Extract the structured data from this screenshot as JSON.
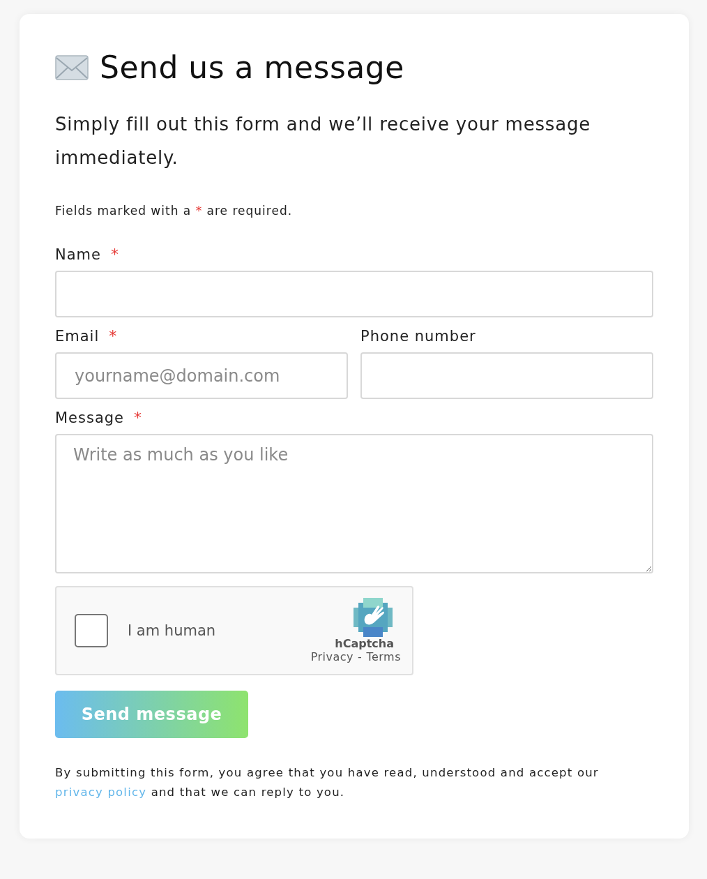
{
  "title": "Send us a message",
  "intro": "Simply fill out this form and we’ll receive your message immediately.",
  "required_note": {
    "before": "Fields marked with a",
    "mark": "*",
    "after": "are required."
  },
  "rows": [
    [
      {
        "label": "Name",
        "required_mark": "*",
        "kind": "text"
      }
    ],
    [
      {
        "label": "Email",
        "required_mark": "*",
        "kind": "text",
        "placeholder": "yourname@domain.com"
      },
      {
        "label": "Phone number",
        "kind": "text"
      }
    ],
    [
      {
        "label": "Message",
        "required_mark": "*",
        "kind": "textarea",
        "placeholder": "Write as much as you like"
      }
    ]
  ],
  "captcha": {
    "label": "I am human",
    "checked": false,
    "brand": "hCaptcha",
    "links": [
      "Privacy",
      "Terms"
    ],
    "separator": "-"
  },
  "submit": "Send message",
  "consent": {
    "before": "By submitting this form, you agree that you have read, understood and accept our",
    "link": "privacy policy",
    "after": "and that we can reply to you."
  }
}
